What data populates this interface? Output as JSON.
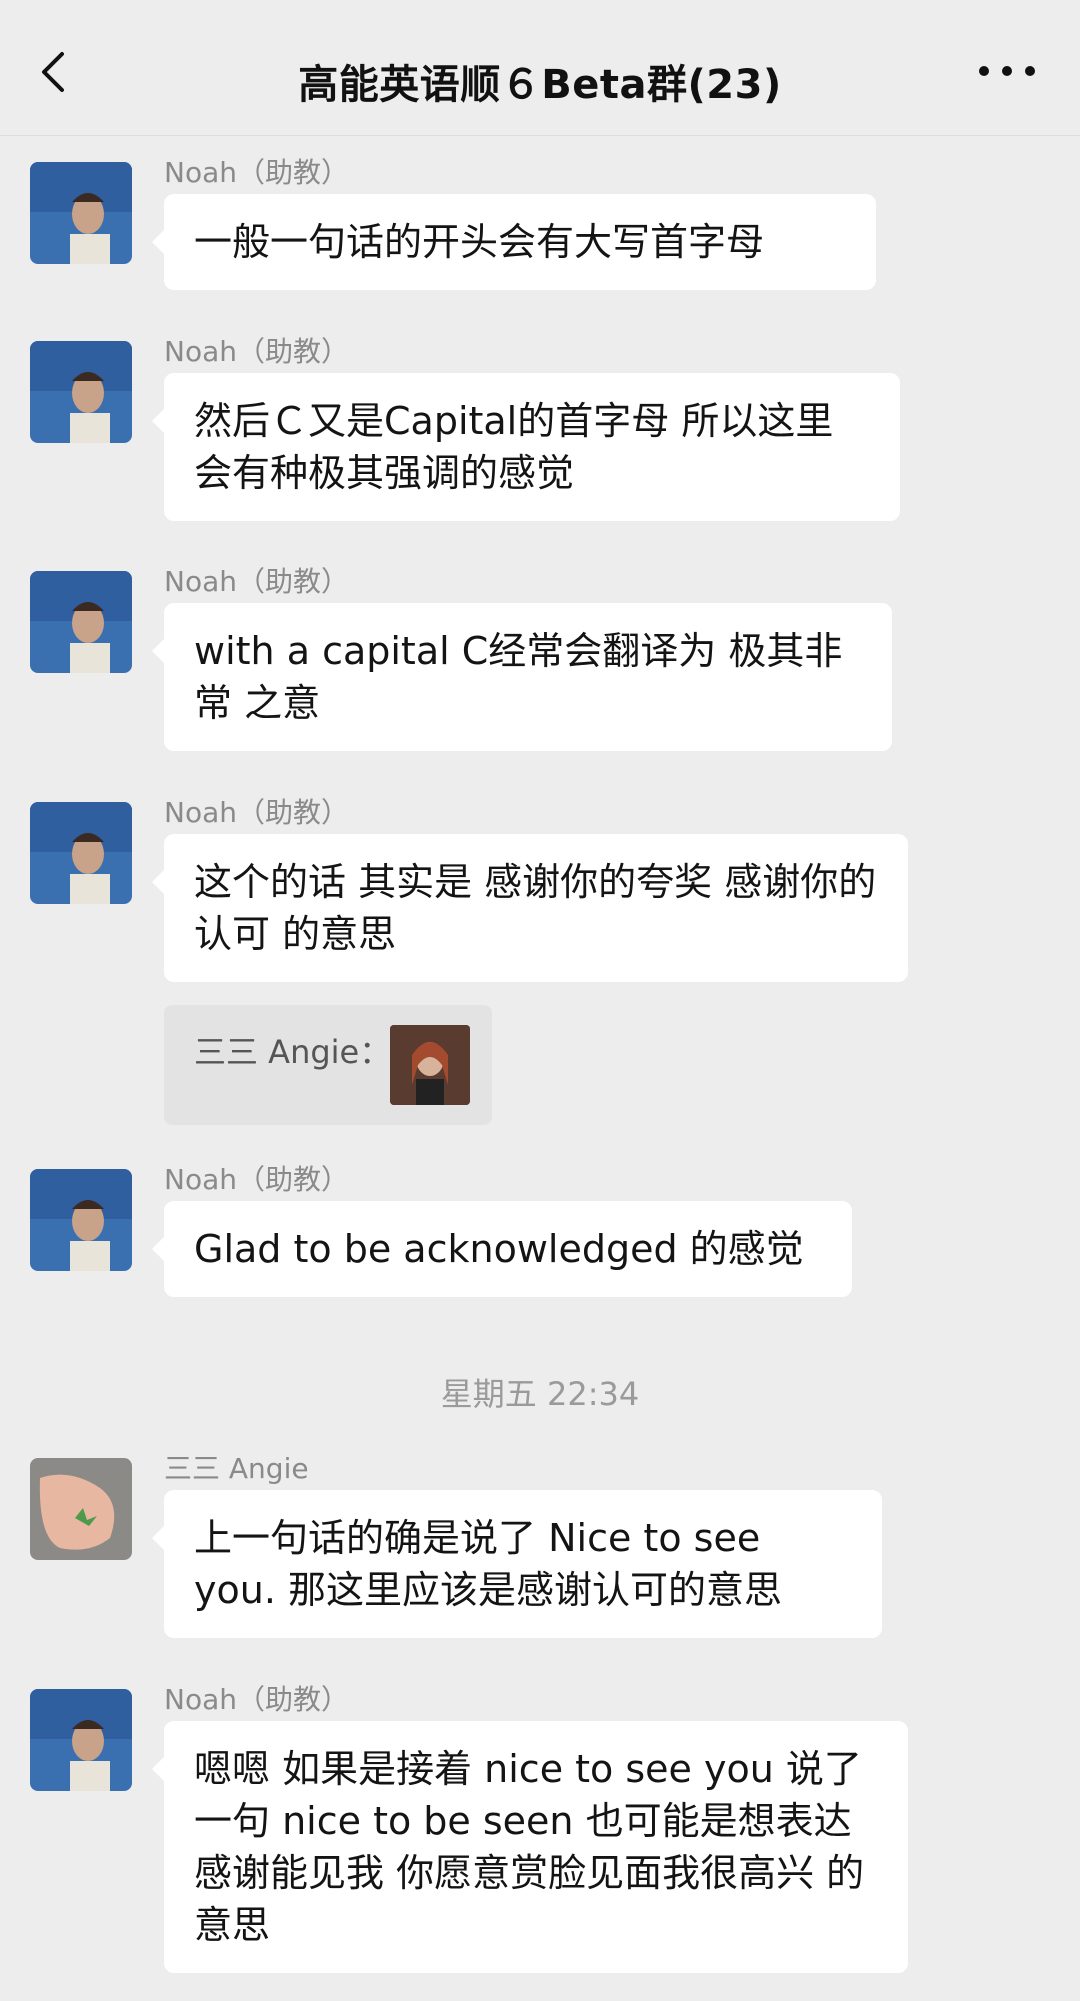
{
  "header": {
    "title": "高能英语顺６Beta群(23)"
  },
  "messages": [
    {
      "sender": "Noah（助教）",
      "text": "一般一句话的开头会有大写首字母"
    },
    {
      "sender": "Noah（助教）",
      "text": "然后Ｃ又是Capital的首字母 所以这里会有种极其强调的感觉"
    },
    {
      "sender": "Noah（助教）",
      "text": "with a capital C经常会翻译为 极其非常 之意"
    },
    {
      "sender": "Noah（助教）",
      "text": "这个的话 其实是 感谢你的夸奖 感谢你的认可 的意思"
    },
    {
      "sender": "Noah（助教）",
      "text": "Glad to be acknowledged 的感觉"
    },
    {
      "sender": "三三 Angie",
      "text": "上一句话的确是说了 Nice to see you. 那这里应该是感谢认可的意思"
    },
    {
      "sender": "Noah（助教）",
      "text": "嗯嗯 如果是接着 nice to see you 说了一句 nice to be seen 也可能是想表达 感谢能见我  你愿意赏脸见面我很高兴  的意思"
    }
  ],
  "quote": {
    "label": "三三 Angie："
  },
  "timestamp": "星期五 22:34"
}
